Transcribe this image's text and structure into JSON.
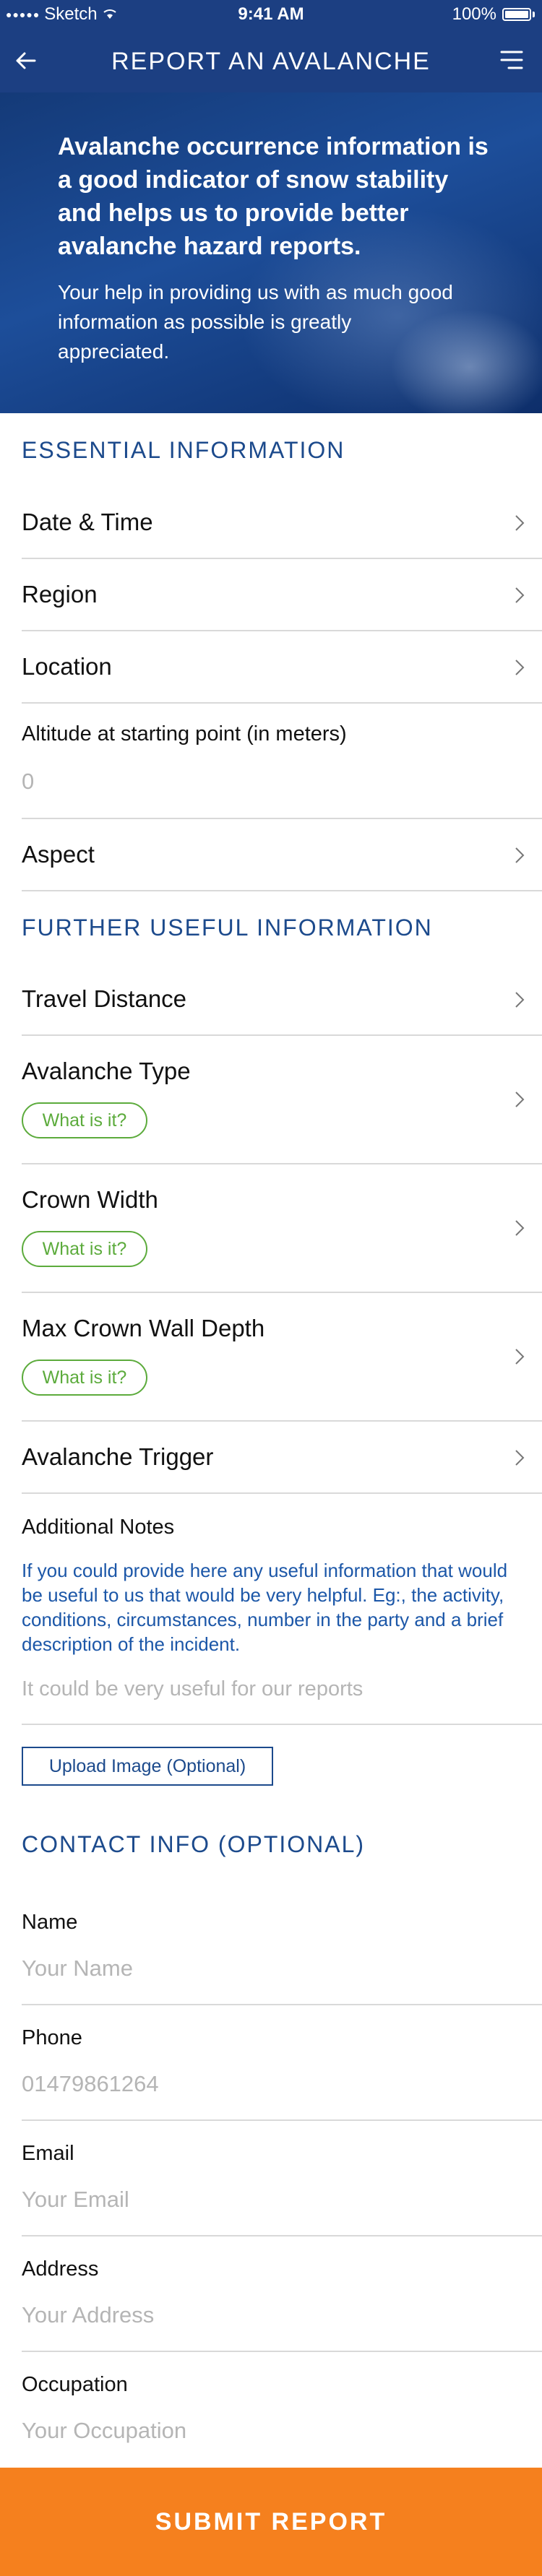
{
  "status_bar": {
    "carrier": "Sketch",
    "time": "9:41 AM",
    "battery": "100%"
  },
  "nav": {
    "title": "REPORT AN AVALANCHE"
  },
  "hero": {
    "lead": "Avalanche occurrence information is a good indicator of snow stability and helps us to provide better avalanche hazard reports.",
    "sub": "Your help in providing us with as much good information as possible is greatly appreciated."
  },
  "essential": {
    "title": "ESSENTIAL INFORMATION",
    "date_time": "Date & Time",
    "region": "Region",
    "location": "Location",
    "altitude_label": "Altitude at starting point (in meters)",
    "altitude_value": "0",
    "aspect": "Aspect"
  },
  "further": {
    "title": "FURTHER USEFUL INFORMATION",
    "travel_distance": "Travel Distance",
    "avalanche_type": "Avalanche Type",
    "crown_width": "Crown Width",
    "max_crown_wall_depth": "Max Crown Wall Depth",
    "avalanche_trigger": "Avalanche Trigger",
    "what_is_it": "What is it?",
    "notes_label": "Additional Notes",
    "notes_body": "If you could provide here any useful information that would be useful to us that would be very helpful. Eg:, the activity, conditions, circumstances, number in the party and a brief description of the incident.",
    "notes_placeholder": "It could be very useful for our reports",
    "upload_label": "Upload Image (Optional)"
  },
  "contact": {
    "title": "CONTACT INFO (OPTIONAL)",
    "name_label": "Name",
    "name_placeholder": "Your Name",
    "phone_label": "Phone",
    "phone_value": "01479861264",
    "email_label": "Email",
    "email_placeholder": "Your Email",
    "address_label": "Address",
    "address_placeholder": "Your Address",
    "occupation_label": "Occupation",
    "occupation_placeholder": "Your Occupation"
  },
  "submit_label": "SUBMIT REPORT",
  "colors": {
    "brand_blue": "#1c3f82",
    "section_blue": "#1c4a8c",
    "green": "#5cab3c",
    "orange": "#f5801e"
  }
}
